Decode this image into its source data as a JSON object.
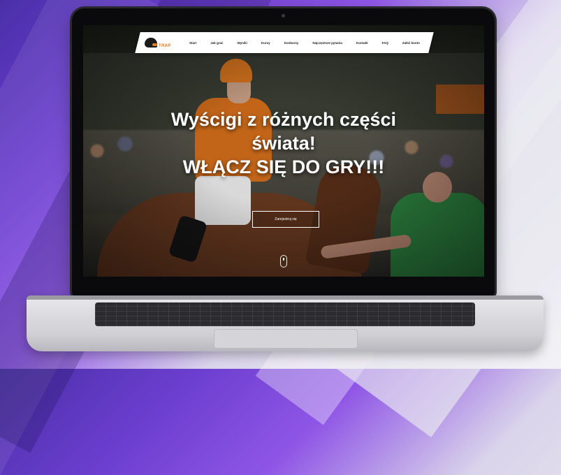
{
  "site": {
    "logo_text": "TRAP",
    "nav": [
      "Start",
      "Jak grać",
      "Wyniki",
      "Kursy",
      "Konkursy",
      "Najczęstsze pytania",
      "Kontakt",
      "FAQ",
      "Załóż konto"
    ]
  },
  "hero": {
    "line1": "Wyścigi z różnych części",
    "line2": "świata!",
    "line3": "WŁĄCZ SIĘ DO GRY!!!",
    "cta_label": "Zarejestruj się"
  },
  "colors": {
    "accent": "#e37b20",
    "background_purple": "#6d3fd0"
  }
}
